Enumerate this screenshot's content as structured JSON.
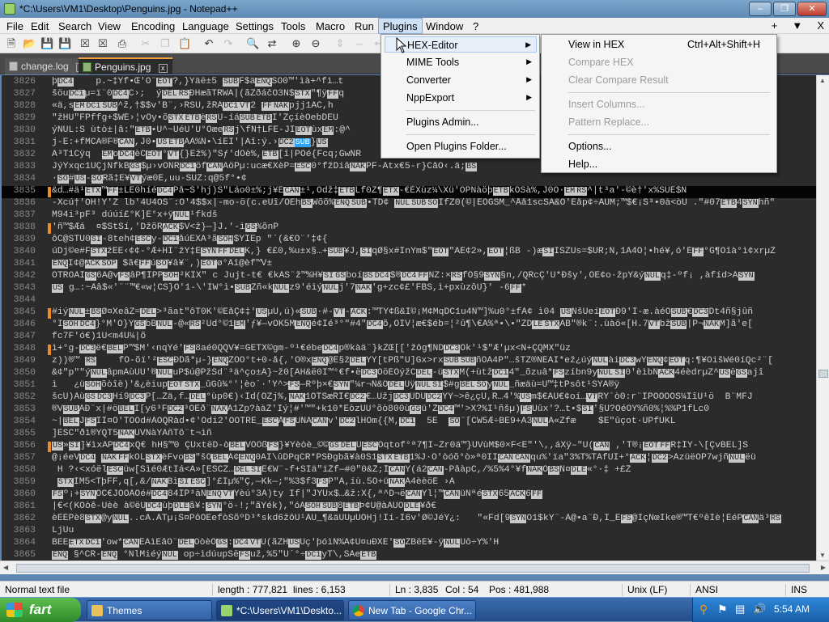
{
  "window": {
    "title": "*C:\\Users\\VM1\\Desktop\\Penguins.jpg - Notepad++"
  },
  "menubar": {
    "items": [
      "File",
      "Edit",
      "Search",
      "View",
      "Encoding",
      "Language",
      "Settings",
      "Tools",
      "Macro",
      "Run",
      "Plugins",
      "Window",
      "?"
    ],
    "right_items": [
      "+",
      "▼",
      "X"
    ]
  },
  "tabs": [
    {
      "label": "change.log",
      "close": "x",
      "selected": false
    },
    {
      "label": "Penguins.jpg",
      "close": "x",
      "selected": true
    }
  ],
  "plugins_menu": {
    "items": [
      {
        "label": "HEX-Editor",
        "submenu": true,
        "highlighted": true
      },
      {
        "label": "MIME Tools",
        "submenu": true
      },
      {
        "label": "Converter",
        "submenu": true
      },
      {
        "label": "NppExport",
        "submenu": true
      },
      {
        "label": "Plugins Admin...",
        "submenu": false
      },
      {
        "label": "Open Plugins Folder...",
        "submenu": false
      }
    ]
  },
  "hex_menu": {
    "items": [
      {
        "label": "View in HEX",
        "shortcut": "Ctrl+Alt+Shift+H",
        "enabled": true
      },
      {
        "label": "Compare HEX",
        "shortcut": "",
        "enabled": false
      },
      {
        "label": "Clear Compare Result",
        "shortcut": "",
        "enabled": false
      },
      {
        "label": "Insert Columns...",
        "shortcut": "",
        "enabled": false
      },
      {
        "label": "Pattern Replace...",
        "shortcut": "",
        "enabled": false
      },
      {
        "label": "Options...",
        "shortcut": "",
        "enabled": true
      },
      {
        "label": "Help...",
        "shortcut": "",
        "enabled": true
      }
    ]
  },
  "editor": {
    "current_line": "3835",
    "lines": [
      {
        "n": "3826",
        "t": "þ[DC4]    p.~‡Ÿf•Œ'Ô¨[EOT]?,}Ÿäë±5 [SUB]F$ä[ENQ]SO0™'ìà+^fì…t"
      },
      {
        "n": "3827",
        "t": "šöu[DC1]µ=ï¨0[DC4]C›;  ý[DEL][RS]ÐHæãTRWÄ|(ãZðáčO3N$[STX]\"¶ÿ[FF]q"
      },
      {
        "n": "3828",
        "t": "«ä,s[EM][DC1][SUB]^ž,†$$v'B¨,›RSÙ,žRÁ[DC1][VT]2¯[FF][NAK]pjj1AC,h"
      },
      {
        "n": "3829",
        "t": "\"žHU\"FPffg+$WÉ›¦vÕy•õ[STX][ETB]è[RS]Û-íá[SUB][ETB]I'ŽçíèOebDEÜ"
      },
      {
        "n": "3830",
        "t": "ýNUL:S ùtò±|â:\"[ETB]•Û^~ÚéÙ'Ù°Õæe[RS]j\\fÑ†LFÊ-JI[EOT]ùx[EM]:@^"
      },
      {
        "n": "3831",
        "t": "j-Ë:+fMCA®F®[CAN],J0•[US][ETB]ÃÃ%N•\\íËÍ'|Äî:ý.›[DC2][SUB]}[US]"
      },
      {
        "n": "3832",
        "t": "Ä³T1Cÿq  [EM]o[DC4]èC[EOT]°[VT]{}Ež%)\"Šƒ'dÔè%,[ETB][î|PÕé{Fcq;GwÑR"
      },
      {
        "n": "3833",
        "t": "JýŸxqc1ÛÇjÑfkB[GS]$µ›vÔÑR[DC1]öf[CAN]AöPµ:ucæ€XèP=[ESC]0°fžDiâ[NAK]PF-Âtx€5-r}CåÒ‹.ä;[BS]"
      },
      {
        "n": "3834",
        "t": "·[SO]#[US]-[SO]Rã‡E¥[VT]ýæ0É,uu-SUŽ:q@5f°•¢"
      },
      {
        "n": "3835",
        "t": "&d…#ä¹[ETX]™[FF]±LE0híé[DC4]På~Š'hj)Š\"Láo0±%;j¥É[CAN]±¹,Ödž‡[ETB]Lf0Z¶[ETX]-€ÉXùz¼\\Xü'ÕPNàöþ[ETB]kÕSà%,J0Ò·[EM][RS]^|t³a'-©è†'x%SUÉ$Ñ"
      },
      {
        "n": "3836",
        "t": "-Xcú†'ÓH!Y'Ž lb'4U4ÒŠ¨:O'4$$x|-mo-ö(c.eÜî/ÕËh[BS]Wõõ%[ENQ][SUB]•TD¢¯[NUL][SUB][SO]ÏfZ0(©|ÉÕGSM_^Åå1scŠÄ&O'Eåp¢÷ÃUM;™$€¡Š³•0à<òÙ .\"#07[ETB]4[SYN]hñ\""
      },
      {
        "n": "3837",
        "t": "M94i³pF³ dúúí£°K]E°x+ÿ[NUL]¹fkdš"
      },
      {
        "n": "3838",
        "t": "'ñ™$Æá  ¤$ŠtŠí,'DžõR[ACK]$V<ž}—]J.'-ì[GS]%õnP"
      },
      {
        "n": "3839",
        "t": "ôC@ŠTU0[SI]-8teh¢[ESC]y-[DC1]åúEXÄ³ã[SOH]$ŸÎEp \"`(&€Ô¨'‡¢{"
      },
      {
        "n": "3840",
        "t": "úDj©e#F[STX]žÊÈ‹¢¢-°Æ+HI¨žŸ‡Ê[SYN][FF][DEL]K,}¯€£0,%u±x§…+[SUB]¥J,[SI]qØ§x#ÍnŸm$\"[EOT]\"ÄÉ¢2»,[EOT]¦ßB -)æ[SI]IŠZÚs=$UR;Ñ,1Â4Ò¦•hé¥,ó'É[FF]°G¶Oîà°ì¢xrµŽ"
      },
      {
        "n": "3841",
        "t": "[ENQ]Ï¢@[ACK][SOP] $ã€[FF]ú[SO]¥â¥¨,)[EOT]ø°Âî@èf™V±"
      },
      {
        "n": "3842",
        "t": "ÔTRÓÃÍ[GS]6Ã@v[FS]âP¶ÎPP[SOH]²KIX\" c¯Jujt-t€ €kÀŠ¨ž™%H¥[SI][GS]boí[BS][DC4]$®[DC4][FF]NZ:×[RS]fÕ§9[SYN]§n,/QRcÇ'U*Ðšy',ÕE¢o·žpY&ý[NUL]q‡-ºf¡ ,àfíd>Ã[SYN]"
      },
      {
        "n": "3843",
        "t": "[US]¯g…:~Ââ$«'¨¨™€«w¦CS}Ò'1-\\'IW°ì•[SUB]Žñ«k[NUL]z9'éìý[NUL]j'7[NAK]'g+zc¢£'FBS,ì+pxùzôU}' -6[FF]*"
      },
      {
        "n": "3844",
        "t": ""
      },
      {
        "n": "3845",
        "t": "#iý[NUL]±[BS]Ø¤XeâZ=[DEL]>³ãat\"ôT0K'©EåÇ¢‡'[US]µÛ,ú)«[SUB]·#-[VT]-[ACK]:™TŸ¢ß&Í©¡M¢MqDC1u4Ñ™]%u0°±fÁ¢ ì04 [US]NšUeí[EOT]Ð9'Í-æ.àéÕ[SUB]€[DC3]Dt4ñ§jûñ"
      },
      {
        "n": "3846",
        "t": "°I[SOH][DC4]}°M'Ó}Ý[GS]bB[NUL]-@«[RS]²Ud°©1[EM]'ƒ¥—vOK5M[ENQ]é¢Ìé³°\"#4\"[DC4]õ,ÔÍV¦æ€$éb=¦²û¶\\€Ã%ª•\\•\"ŽD[LE][STX]ÃB\"®k¨:.ùàö«[H.7[VT]bž[SUB]|P¬[NAK]M]ã'e["
      },
      {
        "n": "3847",
        "t": "fc7F'ó€)1Û<m4Ü¼|õ"
      },
      {
        "n": "3848",
        "t": "ì+°g-[DC3]ë€[BEL]P™$M'‹nqÝé'[FS]8aé0QQV¥=GETX©gm-º¹€ébe[DC4]p®kàä¨}kŽŒ[['žôg¶ÑD[DC3]Ök'¹$\"Æ'µx<N+ÇQMX\"üz"
      },
      {
        "n": "3849",
        "t": "z))®™ [RS]    fÕ-õï'²[ESC]ÐDã*µ-}[ENQ]ŽÕO°t+0-å{,'Ö®x[ENQ]@Ê§ž[DEL]YY[tPß\"Ú]Gx>rx[SUB][SUB]ñÕÁ4P\"…šTZ®NÉÃI*ež¿úý[NUL]ài[DC3]wY[ENQ]¢[EOT]q:¶¥ÒišWé0íQc²¨["
      },
      {
        "n": "3850",
        "t": "&¢\"p\"\"ý[NUL]âpmÀùÛÛ'®[NUL]uP$ú@PžŠd¨³ä^ço±Ã}~ž0[ÂH&ë0I™°€f•ë[DC3]ÕöÉÕýžC[DEL]-ü[STX]M(+ùtž[DC1]4\"_õzuâ*[FS]zíbn9y[NUL][SI]0'èìbÑ[ACK]4éèdrµZ^[US]ë[GS]ajî"
      },
      {
        "n": "3851",
        "t": "ì   ¿ü[SOH]õòîè)'&¿èiup[EOT][STX]_ûGû¾°'¦èo´·'Ý^>[FS]—Rºþ×€[SYN]\"¼r¬Ñ&Ô[DEL]Üÿ[NUL][SI]$#g[BEL][SO]y[NUL]_ñæäù=Ü™‡tPsôt¹ŠŸÄ®ÿ"
      },
      {
        "n": "3852",
        "t": "šcÜ)Ãù[GS][DC3]Hí9[DC3]P[…Žä,f…[DEL]°ùp0€)‹Ìd(ÔZj%,[NAK]1ÖTSæRÎ€[DC2]€…Üžj[DC3]ÜDÚ[DC2]ÝY~>ê¿çÚ,R…4'%[US]m$€ÁÚ€¢oí…[VT]RŸ`ò0:r¨ÌPÓÔÕÕS¼ÎîÛ¹ö  B¨MFJ"
      },
      {
        "n": "3853",
        "t": "®V[SUB]ÃÐ¨x|#ö[BEL]Ï[y6³F[DC2]³ÓEð¨[NAK]Ã1Zp?ààŽ'Ìý¦#'™\"+k10*EòzÚÛ°õò800ù[GS]ü'Ž[DC4]™'>X?%Ì¹ñšµ)[FS]Ûûx'?…t•$[SI]'§Ü?OéÓÝ%ñ0%¦%%P1fLc0"
      },
      {
        "n": "3854",
        "t": "~|[BEL]J[FS]ÎÌ¤Ô'TÕÔd#ÁÓQRàd•¢'Ôdi2'ÔÖTRÈ_[ESC]Å[FS]UÑÃ[CAN]v'[DC2]lHÕm{{M,[DC1]  5E  [SO]¨[CW5Æ÷BÈ9+Ã3[NUL]Ã«Žfæ    $Ê\"ûçot·ÙPfÛKL"
      },
      {
        "n": "3855",
        "t": "]ÈSC\"ðì®ŸQT5[NAK]UVNàŸÂñTô¨t¬ìñ"
      },
      {
        "n": "3856",
        "t": "[US]»[SI]]¥ìxÂP[DC4]xQ€ hH§™0 ÇÜxtëD-ò[BEL]VÕÕß[FS]}¥Ÿèòè_©©[GS][DEL]Ü[ESC]Oqtof°ª7¶Ï–Žr0ä™}ÜVùM$0×F<Ê\"'\\,,áXÿ–\"Û([CAN] ,'T®¡[EOT][FF]R‡ÎŸ-\\[ÇvBEL]Š"
      },
      {
        "n": "3857",
        "t": "@¡éeV[DC4] [NAK][FF]kOL[STX]èFvo[BS]\"šÖ[BEL]Á¢[ENQ]0ÃI\\ûDPqCR*PSÐgbã¥à0S1[STX][ETB]1%J·Õ'òóõ°ò»ª0ÏI[CAN][CAN]qu%'ïa\"3%T%TÃfÛI+°[ACK]¦[DC2]>ÃzüëÒP7wjñ[NUL]ëü"
      },
      {
        "n": "3858",
        "t": " H ?‹<xóël[ESC]üw[Sìé0ÆtIá<Ä»[ESCZ…[DEL][SI]Ë€W¨-f+SIä\"ïŽf—#0\"0&Ž;Í[CAN]Y(á2[CAN]-PåàpC,/%5%4°¥f[NAK]Õ[BS]Ñ¤[DLE]«°·‡ +£Ž"
      },
      {
        "n": "3859",
        "t": " [STX]ÍM5<TþFF,q[,&/[NAK]Bì[SI][ESC]]°£Iµ%\"Ç,—Kk—;\"%3$f3[FS]P\"Ã,íù.5Ò+ü[NAK]Á4èèöÈ ›À"
      },
      {
        "n": "3860",
        "t": "[FS]º¡+[SYN]ÕC€JÕÕÃÕé#[DC4]84IP³àÑ[ENQ][VT]Ÿèú°3Ã)ty If|\"JŸÜx$…&ž:X{,ª^D¬ë[CAN]Yl¦™[CAN]üNªé[STX]65[ACK]6[FF]"
      },
      {
        "n": "3861",
        "t": "|€<(KÒòê-Ûèè à©ëÛ[DC4]ùþ[DLE]ã¥:[SYN]°ö-!;\"ãYék),\"óÁ[SOH][SUB]8[ETB]Þ¢Ü@àÀÜÕ[DLE]¥ð€"
      },
      {
        "n": "3862",
        "t": "èÉÉPè8[STX]@y[NUL]..cÃ.ÃTµ¡S¤PôÕËefòŠõºD³*skd6žôÛ¹ÃÛ_¶&äÛÛµÛÕHj!Ïí-Í6v'Ø©JéÝ¿:   \"«Fd[9[SYN]Ö1$kŸ¨-Ã@•a¨Ð,I_E[FS]@ÌçNœÌke®™T€ºêÍè¦ÉéP[CAN]ä³[RS]"
      },
      {
        "n": "3863",
        "t": "LjUu"
      },
      {
        "n": "3864",
        "t": "BEE[ETX][DC1]'ow*[CAN]EAìEâÕ¨[DEL]OòèÕ[GS]:[DC4][VT]Û(ãZH[US]Ùç'þóìÑ%Ã¢Ù¤uÐXÉ'[SO]ŽBëÉ¥-ÿ[NUL]Uô÷Y%'H"
      },
      {
        "n": "3865",
        "t": "[ENQ] §^CR-[ENQ] °NlMiéý[NUL] op÷ìdúupŠë[FS]už,%5\"Û´°÷[DC1]yT\\,ŠÀe[ETB]"
      }
    ],
    "marked_lines": [
      "3835",
      "3838",
      "3845",
      "3848",
      "3856"
    ]
  },
  "statusbar": {
    "type": "Normal text file",
    "length": "length : 777,821",
    "lines": "lines : 6,153",
    "ln": "Ln : 3,835",
    "col": "Col : 54",
    "pos": "Pos : 481,988",
    "eol": "Unix (LF)",
    "encoding": "ANSI",
    "mode": "INS"
  },
  "taskbar": {
    "start": "fart",
    "tasks": [
      {
        "label": "Themes",
        "active": false
      },
      {
        "label": "*C:\\Users\\VM1\\Deskto...",
        "active": true
      },
      {
        "label": "New Tab - Google Chr...",
        "active": false
      }
    ],
    "clock": "5:54 AM"
  }
}
